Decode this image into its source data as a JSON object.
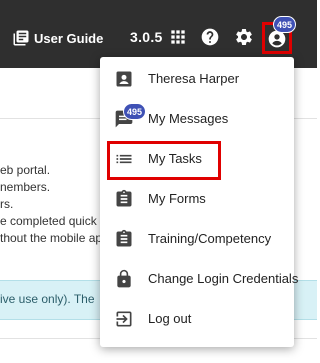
{
  "header": {
    "guide_label": "User Guide",
    "version": "3.0.5",
    "notification_badge": "495"
  },
  "page": {
    "lines": [
      "eb portal.",
      "nembers.",
      "rs.",
      "e completed quick",
      "thout the mobile ap"
    ],
    "info_text": "ive use only). The"
  },
  "menu": {
    "items": [
      {
        "label": "Theresa Harper",
        "icon": "person-badge-icon"
      },
      {
        "label": "My Messages",
        "icon": "message-icon",
        "badge": "495"
      },
      {
        "label": "My Tasks",
        "icon": "list-icon"
      },
      {
        "label": "My Forms",
        "icon": "clipboard-icon"
      },
      {
        "label": "Training/Competency",
        "icon": "clipboard-icon"
      },
      {
        "label": "Change Login Credentials",
        "icon": "lock-icon"
      },
      {
        "label": "Log out",
        "icon": "logout-icon"
      }
    ]
  },
  "colors": {
    "topbar": "#2f2f2f",
    "badge": "#3f51b5",
    "highlight": "#e00000",
    "info_background": "#d8f1f6"
  }
}
